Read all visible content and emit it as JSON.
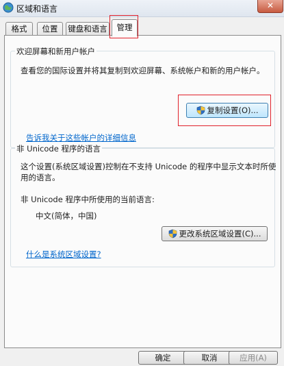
{
  "window": {
    "title": "区域和语言",
    "close_glyph": "✕"
  },
  "tabs": [
    {
      "label": "格式"
    },
    {
      "label": "位置"
    },
    {
      "label": "键盘和语言"
    },
    {
      "label": "管理",
      "active": true
    }
  ],
  "welcome_group": {
    "label": "欢迎屏幕和新用户帐户",
    "description": "查看您的国际设置并将其复制到欢迎屏幕、系统帐户和新的用户帐户。",
    "copy_button": "复制设置(O)...",
    "link": "告诉我关于这些帐户的详细信息"
  },
  "unicode_group": {
    "label": "非 Unicode 程序的语言",
    "description_line1": "这个设置(系统区域设置)控制在不支持 Unicode 的程序中显示文本时所使",
    "description_line2": "用的语言。",
    "current_label": "非 Unicode 程序中所使用的当前语言:",
    "current_value": "中文(简体，中国)",
    "change_button": "更改系统区域设置(C)...",
    "link": "什么是系统区域设置?"
  },
  "footer": {
    "ok": "确定",
    "cancel": "取消",
    "apply": "应用(A)"
  },
  "colors": {
    "highlight": "#e0202a",
    "link": "#0066cc"
  },
  "icons": {
    "window": "globe-icon",
    "uac": "shield-icon"
  }
}
